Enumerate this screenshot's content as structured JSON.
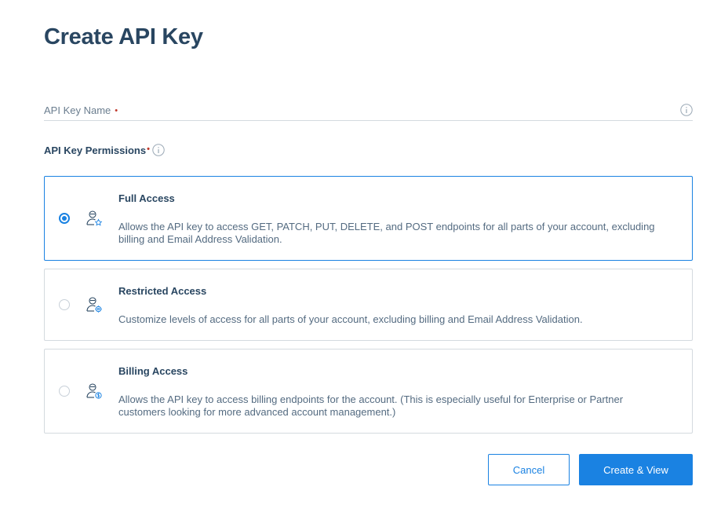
{
  "page": {
    "title": "Create API Key"
  },
  "api_key_name": {
    "label": "API Key Name",
    "required_marker": "•",
    "value": "",
    "info_icon": "info-icon"
  },
  "permissions": {
    "label": "API Key Permissions",
    "required_marker": "•",
    "info_icon": "info-icon",
    "selected": "full",
    "options": [
      {
        "id": "full",
        "title": "Full Access",
        "description": "Allows the API key to access GET, PATCH, PUT, DELETE, and POST endpoints for all parts of your account, excluding billing and Email Address Validation.",
        "icon": "user-star-icon",
        "selected": true
      },
      {
        "id": "restricted",
        "title": "Restricted Access",
        "description": "Customize levels of access for all parts of your account, excluding billing and Email Address Validation.",
        "icon": "user-gear-icon",
        "selected": false
      },
      {
        "id": "billing",
        "title": "Billing Access",
        "description": "Allows the API key to access billing endpoints for the account. (This is especially useful for Enterprise or Partner customers looking for more advanced account management.)",
        "icon": "user-dollar-icon",
        "selected": false
      }
    ]
  },
  "actions": {
    "cancel_label": "Cancel",
    "create_label": "Create & View"
  },
  "colors": {
    "accent": "#1a82e2",
    "heading": "#294661",
    "required": "#c0392b",
    "border": "#d4dadf"
  }
}
